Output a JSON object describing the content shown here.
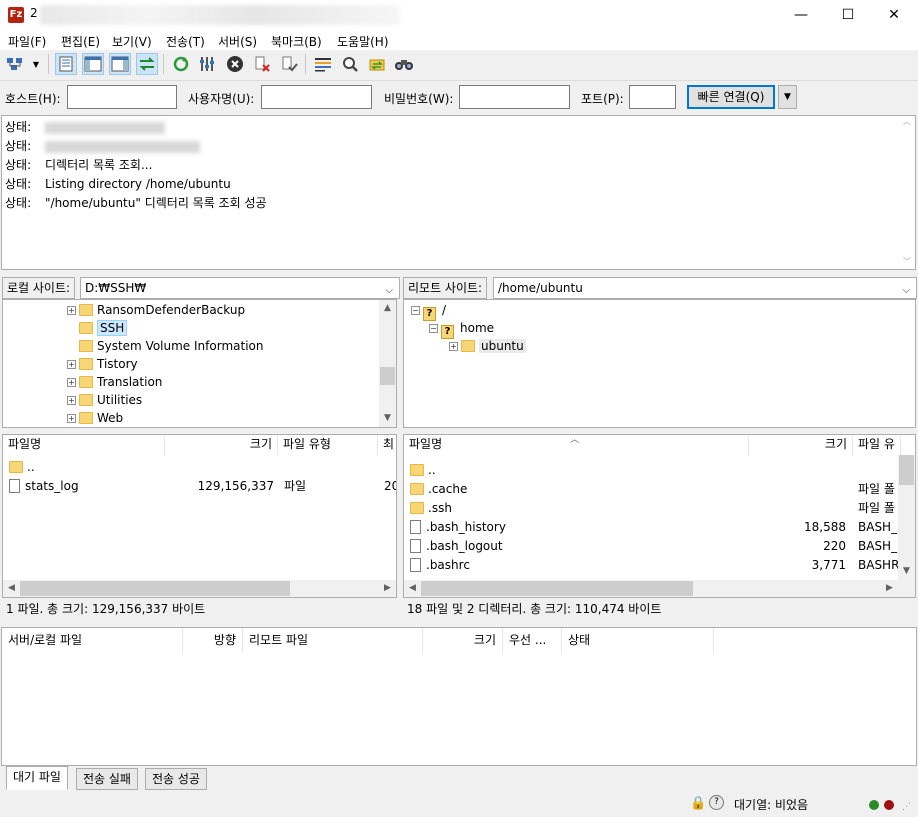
{
  "window": {
    "title_prefix": "2",
    "minimize": "—",
    "maximize": "☐",
    "close": "✕"
  },
  "menu": [
    "파일(F)",
    "편집(E)",
    "보기(V)",
    "전송(T)",
    "서버(S)",
    "북마크(B)",
    "도움말(H)"
  ],
  "quickconnect": {
    "host_label": "호스트(H):",
    "user_label": "사용자명(U):",
    "pass_label": "비밀번호(W):",
    "port_label": "포트(P):",
    "host_value": "",
    "user_value": "",
    "pass_value": "",
    "port_value": "",
    "connect_button": "빠른 연결(Q)",
    "dropdown_glyph": "▼"
  },
  "log": {
    "lines": [
      {
        "key": "상태:",
        "text": ""
      },
      {
        "key": "상태:",
        "text": ""
      },
      {
        "key": "상태:",
        "text": "디렉터리 목록 조회..."
      },
      {
        "key": "상태:",
        "text": "Listing directory /home/ubuntu"
      },
      {
        "key": "상태:",
        "text": "\"/home/ubuntu\" 디렉터리 목록 조회 성공"
      }
    ]
  },
  "local": {
    "site_label": "로컬 사이트:",
    "path": "D:₩SSH₩",
    "tree": [
      {
        "name": "RansomDefenderBackup",
        "expander": "+"
      },
      {
        "name": "SSH",
        "expander": "",
        "selected": true
      },
      {
        "name": "System Volume Information",
        "expander": ""
      },
      {
        "name": "Tistory",
        "expander": "+"
      },
      {
        "name": "Translation",
        "expander": "+"
      },
      {
        "name": "Utilities",
        "expander": "+"
      },
      {
        "name": "Web",
        "expander": "+"
      }
    ],
    "columns": [
      "파일명",
      "크기",
      "파일 유형",
      "최"
    ],
    "files": [
      {
        "name": "..",
        "size": "",
        "type": "",
        "mod": "",
        "kind": "folder"
      },
      {
        "name": "stats_log",
        "size": "129,156,337",
        "type": "파일",
        "mod": "20",
        "kind": "file"
      }
    ],
    "status": "1 파일. 총 크기: 129,156,337 바이트"
  },
  "remote": {
    "site_label": "리모트 사이트:",
    "path": "/home/ubuntu",
    "tree": [
      {
        "name": "/",
        "expander": "−",
        "indent": 0,
        "icon": "q"
      },
      {
        "name": "home",
        "expander": "−",
        "indent": 1,
        "icon": "q"
      },
      {
        "name": "ubuntu",
        "expander": "+",
        "indent": 2,
        "icon": "folder"
      }
    ],
    "columns": [
      "파일명",
      "크기",
      "파일 유"
    ],
    "files": [
      {
        "name": "..",
        "size": "",
        "type": "",
        "kind": "folder"
      },
      {
        "name": ".cache",
        "size": "",
        "type": "파일 폴",
        "kind": "folder"
      },
      {
        "name": ".ssh",
        "size": "",
        "type": "파일 폴",
        "kind": "folder"
      },
      {
        "name": ".bash_history",
        "size": "18,588",
        "type": "BASH_H",
        "kind": "file"
      },
      {
        "name": ".bash_logout",
        "size": "220",
        "type": "BASH_L",
        "kind": "file"
      },
      {
        "name": ".bashrc",
        "size": "3,771",
        "type": "BASHRC",
        "kind": "file"
      }
    ],
    "status": "18 파일 및 2 디렉터리. 총 크기: 110,474 바이트"
  },
  "queue": {
    "columns": [
      "서버/로컬 파일",
      "방향",
      "리모트 파일",
      "크기",
      "우선 ...",
      "상태"
    ],
    "tabs": [
      "대기 파일",
      "전송 실패",
      "전송 성공"
    ]
  },
  "statusbar": {
    "queue_text": "대기열: 비었음"
  }
}
